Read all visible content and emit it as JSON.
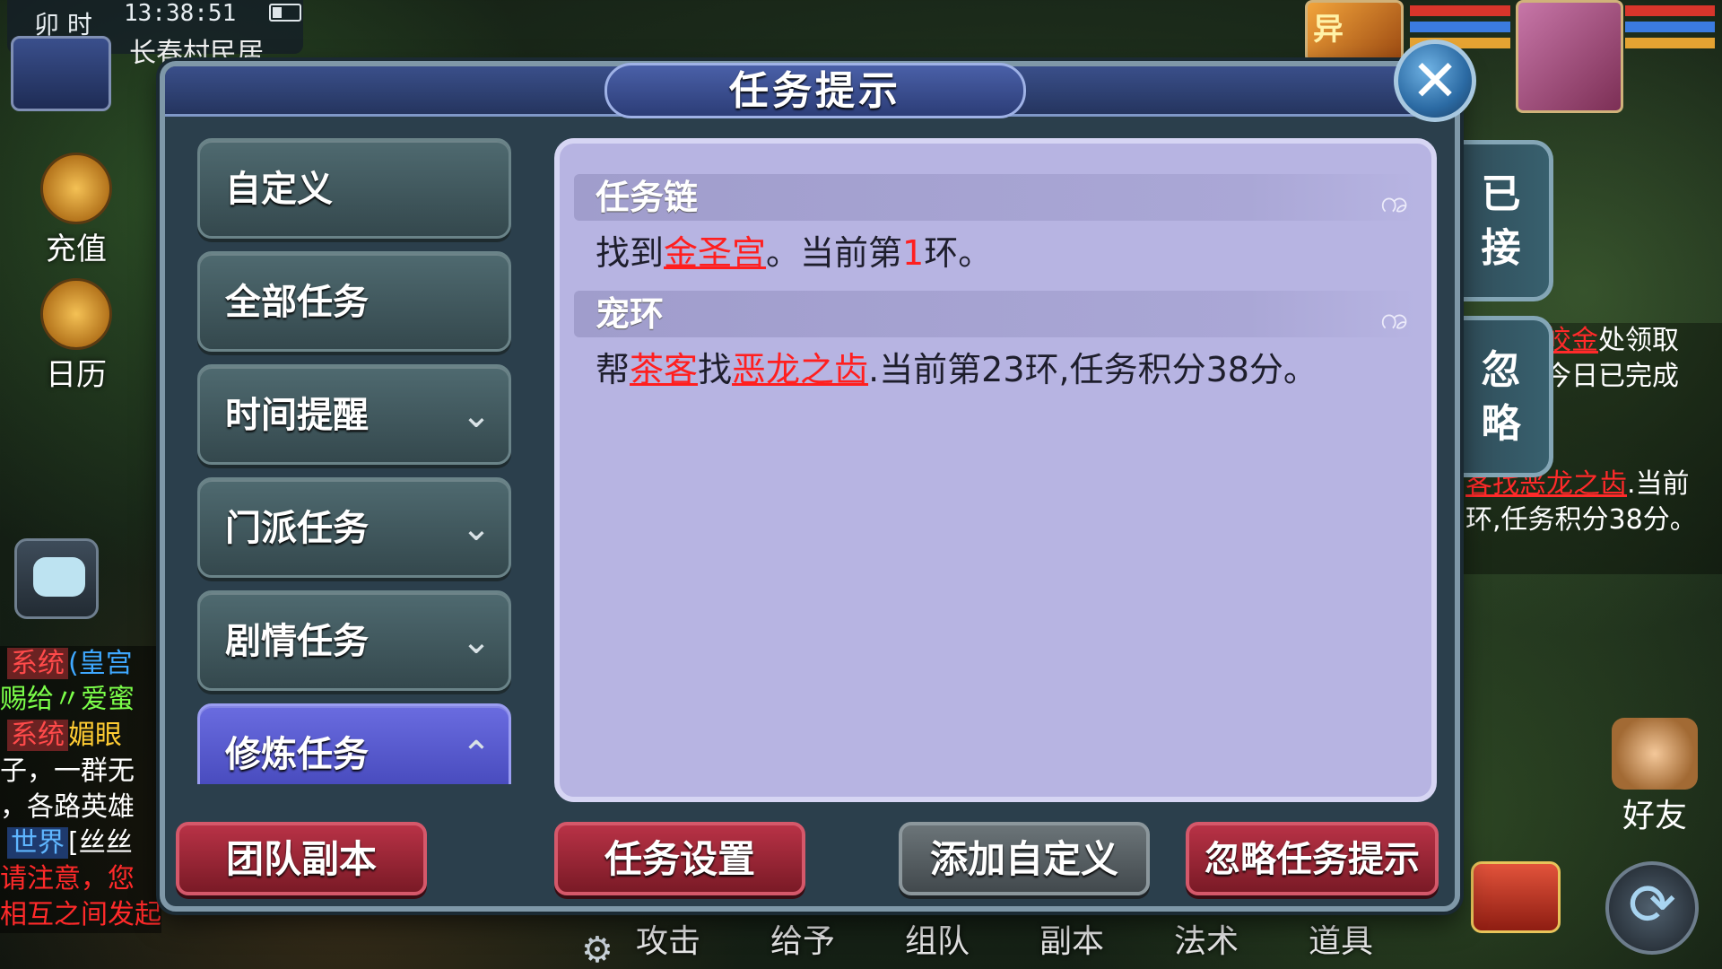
{
  "hud": {
    "shichen": "卯 时",
    "clock": "13:38:51",
    "location": "长春村民居",
    "recharge_label": "充值",
    "calendar_label": "日历",
    "friend_label": "好友",
    "chat": [
      {
        "tag": "系统",
        "text": "(皇宫"
      },
      {
        "tag": "",
        "text": "赐给〃爱蜜"
      },
      {
        "tag": "系统",
        "text": "媚眼"
      },
      {
        "tag": "",
        "text": "子，一群无"
      },
      {
        "tag": "",
        "text": "，各路英雄"
      },
      {
        "tag": "世界",
        "text": "[丝丝"
      },
      {
        "tag": "",
        "text": "请注意，您"
      },
      {
        "tag": "",
        "text": "相互之间发起战斗！"
      }
    ],
    "right_tracker": {
      "line1_hl": "皎金",
      "line1_rest": "处领取",
      "line2": "今日已完成",
      "line3_pre": "客找",
      "line3_hl": "恶龙之齿",
      "line3_rest": ".当前",
      "line4": "环,任务积分38分。"
    },
    "bottom_menu": [
      "攻击",
      "给予",
      "组队",
      "副本",
      "法术",
      "道具"
    ],
    "pet_badge": "异"
  },
  "dialog": {
    "title": "任务提示",
    "categories": [
      {
        "label": "自定义",
        "chevron": "",
        "active": false
      },
      {
        "label": "全部任务",
        "chevron": "",
        "active": false
      },
      {
        "label": "时间提醒",
        "chevron": "⌄",
        "active": false
      },
      {
        "label": "门派任务",
        "chevron": "⌄",
        "active": false
      },
      {
        "label": "剧情任务",
        "chevron": "⌄",
        "active": false
      },
      {
        "label": "修炼任务",
        "chevron": "⌃",
        "active": true
      }
    ],
    "quests": [
      {
        "title": "任务链",
        "parts": [
          {
            "text": "找到",
            "style": "plain"
          },
          {
            "text": "金圣宫",
            "style": "link"
          },
          {
            "text": "。当前第",
            "style": "plain"
          },
          {
            "text": "1",
            "style": "num"
          },
          {
            "text": "环。",
            "style": "plain"
          }
        ]
      },
      {
        "title": "宠环",
        "parts": [
          {
            "text": "帮",
            "style": "plain"
          },
          {
            "text": "茶客",
            "style": "link"
          },
          {
            "text": "找",
            "style": "plain"
          },
          {
            "text": "恶龙之齿",
            "style": "link"
          },
          {
            "text": ".当前第23环,任务积分38分。",
            "style": "plain"
          }
        ]
      }
    ],
    "buttons": {
      "team_dungeon": "团队副本",
      "quest_settings": "任务设置",
      "add_custom": "添加自定义",
      "ignore_hint": "忽略任务提示"
    },
    "side_tabs": {
      "accepted": "已\n接",
      "ignored": "忽\n略"
    }
  }
}
